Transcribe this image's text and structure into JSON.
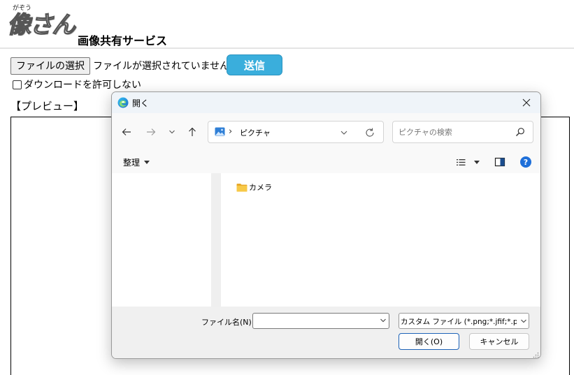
{
  "site": {
    "logo_ruby": "がぞう",
    "logo_text": "像さん",
    "title": "画像共有サービス"
  },
  "form": {
    "choose_button": "ファイルの選択",
    "no_file_text": "ファイルが選択されていません",
    "send_button": "送信",
    "checkbox_label": "ダウンロードを許可しない",
    "preview_label": "【プレビュー】"
  },
  "dialog": {
    "title": "開く",
    "address": {
      "separator": "›",
      "location": "ピクチャ"
    },
    "search": {
      "placeholder": "ピクチャの検索"
    },
    "toolbar": {
      "organize": "整理"
    },
    "items": [
      {
        "name": "カメラ",
        "type": "folder"
      }
    ],
    "footer": {
      "filename_label": "ファイル名(N):",
      "filename_value": "",
      "filter_value": "カスタム ファイル (*.png;*.jfif;*.pjpeg;*.jpeg;*.pjp;*.jpg)",
      "open_button": "開く(O)",
      "cancel_button": "キャンセル"
    }
  },
  "colors": {
    "send_button_bg": "#3aaedc",
    "open_button_border": "#1d63b8",
    "folder_yellow": "#f7c948",
    "help_blue": "#1e6fd9"
  }
}
